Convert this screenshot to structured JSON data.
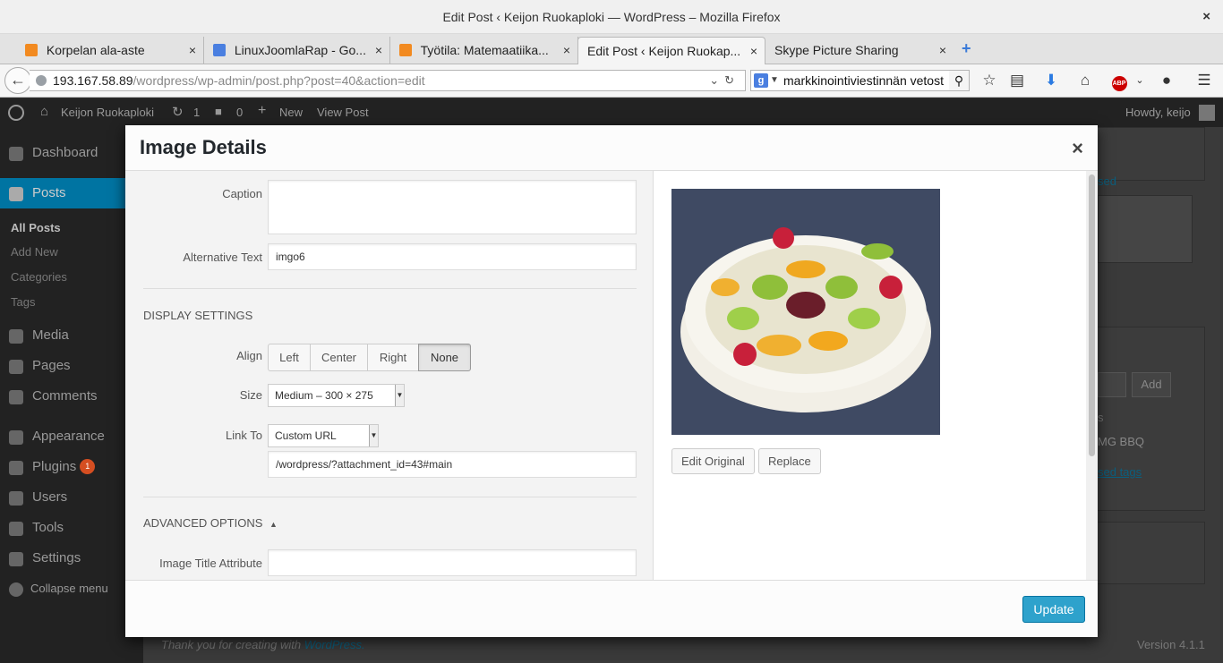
{
  "window": {
    "title": "Edit Post ‹ Keijon Ruokaploki — WordPress – Mozilla Firefox",
    "close_glyph": "×"
  },
  "tabs": [
    {
      "label": "Korpelan ala-aste",
      "icon": "moodle-icon"
    },
    {
      "label": "LinuxJoomlaRap - Go...",
      "icon": "google-docs-icon"
    },
    {
      "label": "Työtila: Matemaatiika...",
      "icon": "moodle-icon"
    },
    {
      "label": "Edit Post ‹ Keijon Ruokap...",
      "icon": "wordpress-icon",
      "active": true
    },
    {
      "label": "Skype Picture Sharing",
      "icon": ""
    }
  ],
  "nav": {
    "url_host": "193.167.58.89",
    "url_path": "/wordpress/wp-admin/post.php?post=40&action=edit",
    "search_value": "markkinointiviestinnän vetost",
    "search_engine": "g"
  },
  "adminbar": {
    "site_name": "Keijon Ruokaploki",
    "updates_count": "1",
    "comments_count": "0",
    "new_label": "New",
    "view_post_label": "View Post",
    "howdy": "Howdy, keijo"
  },
  "sidebar": {
    "dashboard": "Dashboard",
    "posts": "Posts",
    "posts_sub": [
      "All Posts",
      "Add New",
      "Categories",
      "Tags"
    ],
    "media": "Media",
    "pages": "Pages",
    "comments": "Comments",
    "appearance": "Appearance",
    "plugins": "Plugins",
    "plugins_badge": "1",
    "users": "Users",
    "tools": "Tools",
    "settings": "Settings",
    "collapse": "Collapse menu"
  },
  "background": {
    "add_button": "Add",
    "tag_fragment": "MG BBQ",
    "tag_link_fragment": "sed tags",
    "used_fragment": "sed",
    "s_fragment": "s",
    "footer_thanks": "Thank you for creating with",
    "footer_link": "WordPress.",
    "version": "Version 4.1.1"
  },
  "modal": {
    "title": "Image Details",
    "close": "×",
    "caption_label": "Caption",
    "caption_value": "",
    "alt_label": "Alternative Text",
    "alt_value": "imgo6",
    "display_settings": "DISPLAY SETTINGS",
    "align_label": "Align",
    "align_options": [
      "Left",
      "Center",
      "Right",
      "None"
    ],
    "align_selected": "None",
    "size_label": "Size",
    "size_value": "Medium – 300 × 275",
    "link_label": "Link To",
    "link_value": "Custom URL",
    "link_url": "/wordpress/?attachment_id=43#main",
    "advanced_options": "ADVANCED OPTIONS",
    "advanced_arrow": "▲",
    "title_attr_label": "Image Title Attribute",
    "title_attr_value": "",
    "edit_original": "Edit Original",
    "replace": "Replace",
    "update": "Update"
  }
}
